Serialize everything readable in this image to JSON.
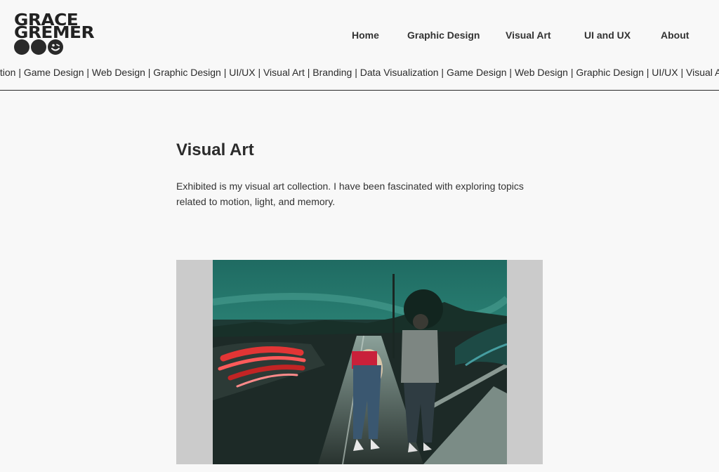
{
  "logo": {
    "line1": "GRACE",
    "line2": "GREMER"
  },
  "nav": {
    "home": "Home",
    "graphic_design": "Graphic Design",
    "visual_art": "Visual Art",
    "ui_ux": "UI and UX",
    "about": "About"
  },
  "ticker": {
    "text": "ization | Game Design | Web Design | Graphic Design | UI/UX | Visual Art | Branding | Data Visualization | Game Design | Web Design | Graphic Design | UI/UX | Visual Art | Branding"
  },
  "page": {
    "title": "Visual Art",
    "description": "Exhibited is my visual art collection. I have been fascinated with exploring topics related to motion, light, and memory."
  },
  "colors": {
    "background": "#f8f8f8",
    "text": "#2b2b2b",
    "frame": "#cbcbcb"
  }
}
